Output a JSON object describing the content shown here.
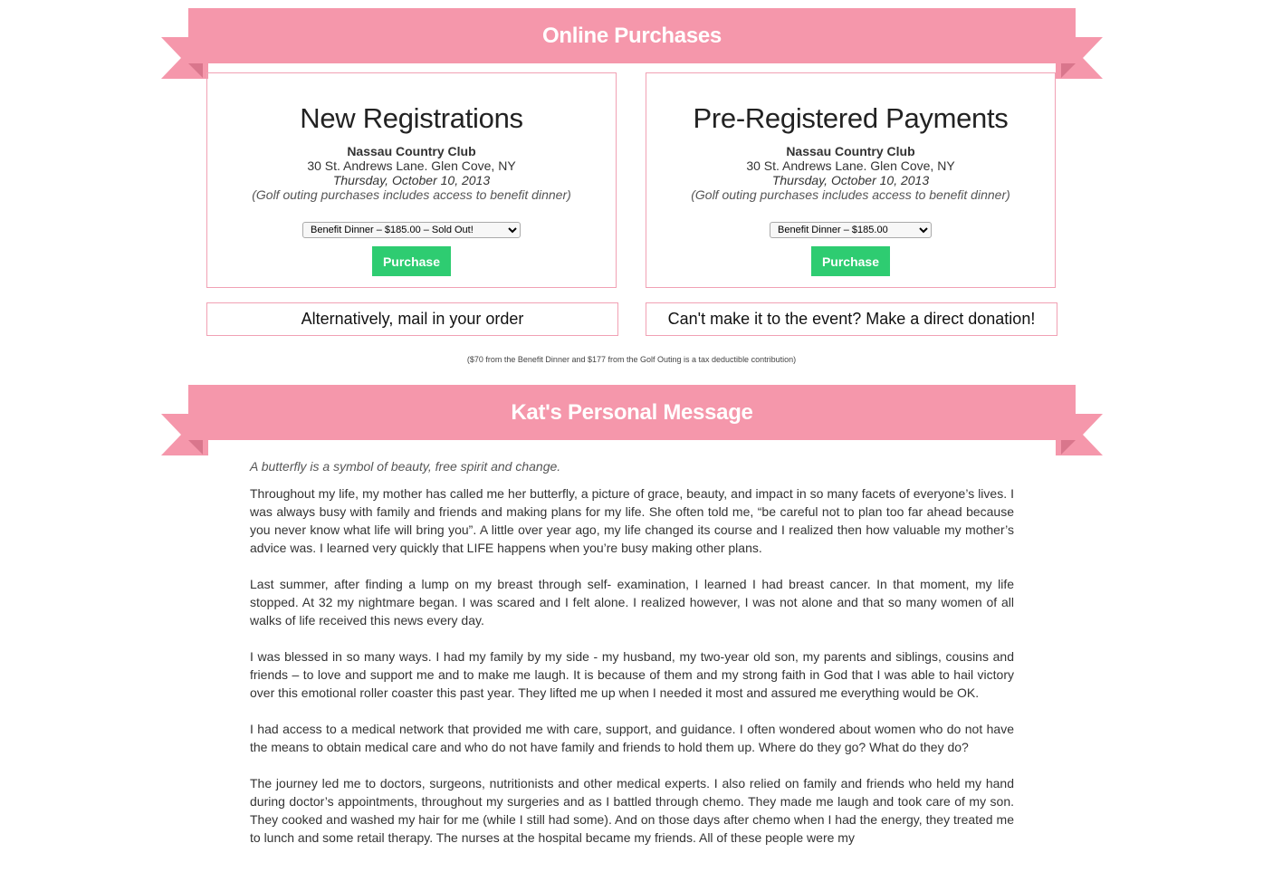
{
  "sections": {
    "purchases_title": "Online Purchases",
    "message_title": "Kat's Personal Message"
  },
  "cards": [
    {
      "title": "New Registrations",
      "venue": "Nassau Country Club",
      "address": "30 St. Andrews Lane. Glen Cove, NY",
      "date": "Thursday, October 10, 2013",
      "note": "(Golf outing purchases includes access to benefit dinner)",
      "select_value": "Benefit Dinner – $185.00 – Sold Out!",
      "button_label": "Purchase"
    },
    {
      "title": "Pre-Registered Payments",
      "venue": "Nassau Country Club",
      "address": "30 St. Andrews Lane. Glen Cove, NY",
      "date": "Thursday, October 10, 2013",
      "note": "(Golf outing purchases includes access to benefit dinner)",
      "select_value": "Benefit Dinner – $185.00",
      "button_label": "Purchase"
    }
  ],
  "links": {
    "mail_order": "Alternatively, mail in your order",
    "donation": "Can't make it to the event? Make a direct donation!"
  },
  "tax_note": "($70 from the Benefit Dinner and $177 from the Golf Outing is a tax deductible contribution)",
  "message": {
    "intro": "A butterfly is a symbol of beauty, free spirit and change.",
    "paragraphs": [
      "Throughout my life, my mother has called me her butterfly, a picture of grace, beauty, and impact in so many facets of everyone’s lives. I was always busy with family and friends and making plans for my life. She often told me, “be careful not to plan too far ahead because you never know what life will bring you”. A little over year ago, my life changed its course and I realized then how valuable my mother’s advice was. I learned very quickly that LIFE happens when you’re busy making other plans.",
      "Last summer, after finding a lump on my breast through self- examination, I learned I had breast cancer. In that moment, my life stopped. At 32 my nightmare began. I was scared and I felt alone. I realized however, I was not alone and that so many women of all walks of life received this news every day.",
      "I was blessed in so many ways. I had my family by my side - my husband, my two-year old son, my parents and siblings, cousins and friends – to love and support me and to make me laugh. It is because of them and my strong faith in God that I was able to hail victory over this emotional roller coaster this past year. They lifted me up when I needed it most and assured me everything would be OK.",
      "I had access to a medical network that provided me with care, support, and guidance. I often wondered about women who do not have the means to obtain medical care and who do not have family and friends to hold them up. Where do they go? What do they do?",
      "The journey led me to doctors, surgeons, nutritionists and other medical experts. I also relied on family and friends who held my hand during doctor’s appointments, throughout my surgeries and as I battled through chemo. They made me laugh and took care of my son. They cooked and washed my hair for me (while I still had some). And on those days after chemo when I had the energy, they treated me to lunch and some retail therapy. The nurses at the hospital became my friends. All of these people were my"
    ]
  },
  "colors": {
    "ribbon": "#f597ab",
    "ribbon_fold": "#d9768c",
    "border": "#f1a1b4",
    "button": "#2ecc71"
  }
}
